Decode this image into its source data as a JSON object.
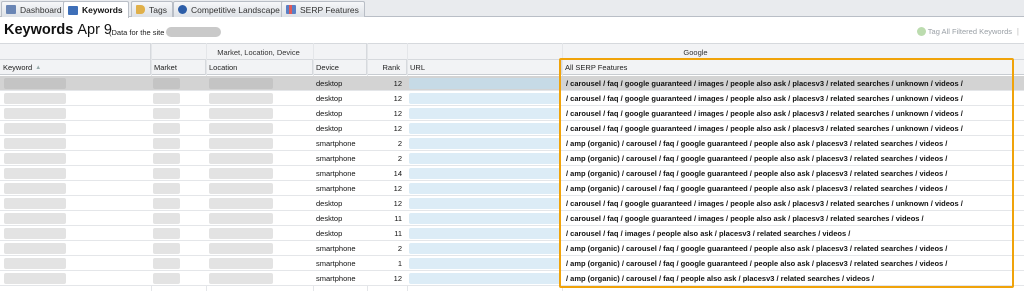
{
  "tabs": [
    {
      "label": "Dashboard",
      "icon": "dashboard-icon",
      "color": "#6a86b5"
    },
    {
      "label": "Keywords",
      "icon": "keywords-icon",
      "color": "#3e6fb8",
      "active": true
    },
    {
      "label": "Tags",
      "icon": "tag-icon",
      "color": "#e0b04a"
    },
    {
      "label": "Competitive Landscape",
      "icon": "competitor-icon",
      "color": "#2d5ea8"
    },
    {
      "label": "SERP Features",
      "icon": "serp-chart-icon",
      "color": "#5a7fc5"
    }
  ],
  "title": {
    "main": "Keywords",
    "date": "Apr 9",
    "site_note": "(Data for the site"
  },
  "tag_all_label": "Tag All Filtered Keywords",
  "groups": {
    "market": "Market, Location, Device",
    "engine": "Google"
  },
  "columns": {
    "keyword": "Keyword",
    "market": "Market",
    "location": "Location",
    "device": "Device",
    "rank": "Rank",
    "url": "URL",
    "serp": "All SERP Features"
  },
  "rows": [
    {
      "device": "desktop",
      "rank": "12",
      "serp": "/ carousel / faq / google guaranteed / images / people also ask / placesv3 / related searches / unknown / videos /"
    },
    {
      "device": "desktop",
      "rank": "12",
      "serp": "/ carousel / faq / google guaranteed / images / people also ask / placesv3 / related searches / unknown / videos /"
    },
    {
      "device": "desktop",
      "rank": "12",
      "serp": "/ carousel / faq / google guaranteed / images / people also ask / placesv3 / related searches / unknown / videos /"
    },
    {
      "device": "desktop",
      "rank": "12",
      "serp": "/ carousel / faq / google guaranteed / images / people also ask / placesv3 / related searches / unknown / videos /"
    },
    {
      "device": "smartphone",
      "rank": "2",
      "serp": "/ amp (organic) / carousel / faq / google guaranteed / people also ask / placesv3 / related searches / videos /"
    },
    {
      "device": "smartphone",
      "rank": "2",
      "serp": "/ amp (organic) / carousel / faq / google guaranteed / people also ask / placesv3 / related searches / videos /"
    },
    {
      "device": "smartphone",
      "rank": "14",
      "serp": "/ amp (organic) / carousel / faq / google guaranteed / people also ask / placesv3 / related searches / videos /"
    },
    {
      "device": "smartphone",
      "rank": "12",
      "serp": "/ amp (organic) / carousel / faq / google guaranteed / people also ask / placesv3 / related searches / videos /"
    },
    {
      "device": "desktop",
      "rank": "12",
      "serp": "/ carousel / faq / google guaranteed / images / people also ask / placesv3 / related searches / unknown / videos /"
    },
    {
      "device": "desktop",
      "rank": "11",
      "serp": "/ carousel / faq / google guaranteed / images / people also ask / placesv3 / related searches / videos /"
    },
    {
      "device": "desktop",
      "rank": "11",
      "serp": "/ carousel / faq / images / people also ask / placesv3 / related searches / videos /"
    },
    {
      "device": "smartphone",
      "rank": "2",
      "serp": "/ amp (organic) / carousel / faq / google guaranteed / people also ask / placesv3 / related searches / videos /"
    },
    {
      "device": "smartphone",
      "rank": "1",
      "serp": "/ amp (organic) / carousel / faq / google guaranteed / people also ask / placesv3 / related searches / videos /"
    },
    {
      "device": "smartphone",
      "rank": "12",
      "serp": "/ amp (organic) / carousel / faq / people also ask / placesv3 / related searches / videos /"
    }
  ],
  "colors": {
    "highlight": "#f0a30a",
    "selected_row": "#d3d3d3",
    "header_bg": "#f2f3f5"
  }
}
